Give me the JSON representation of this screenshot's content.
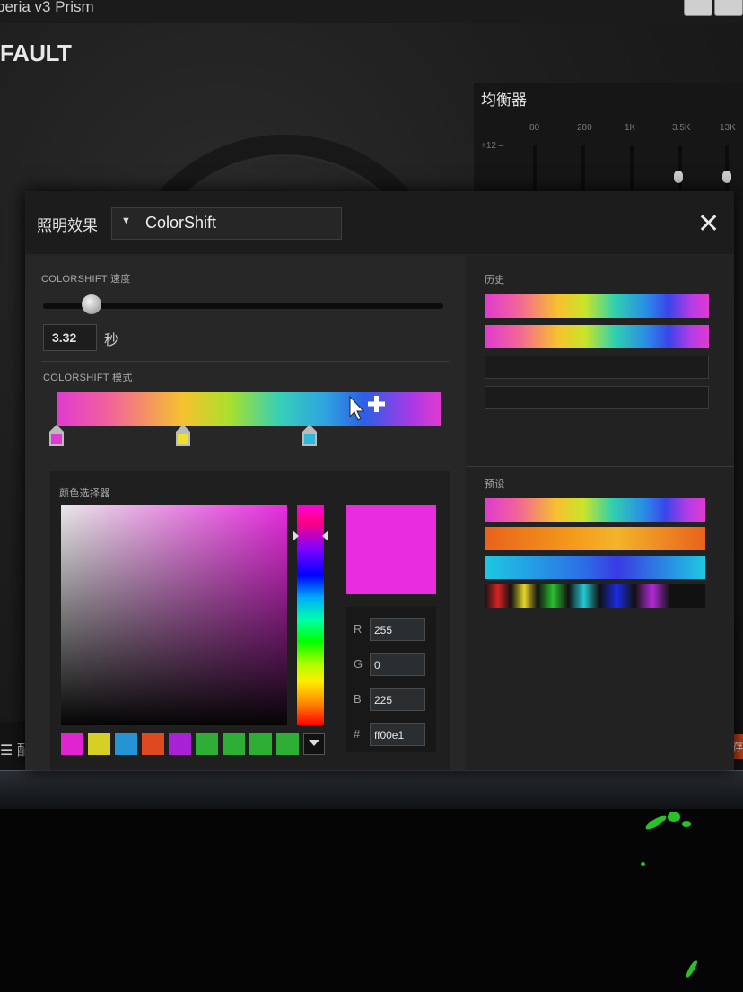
{
  "app": {
    "window_title": "beria v3 Prism",
    "profile_name": "FAULT",
    "equalizer": {
      "title": "均衡器",
      "freqs": [
        "80",
        "280",
        "1K",
        "3.5K",
        "13K"
      ],
      "db_label": "+12 –"
    },
    "bottom_bar": {
      "save_label": "保存",
      "list_label": "☰ 配"
    }
  },
  "dialog": {
    "title": "照明效果",
    "effect": {
      "value": "ColorShift"
    },
    "close_label": "✕",
    "speed": {
      "label": "COLORSHIFT 速度",
      "value": "3.32",
      "unit": "秒",
      "fraction": 0.12
    },
    "pattern": {
      "label": "COLORSHIFT 模式",
      "stops": [
        {
          "color": "#e03ad0",
          "position": 0.0
        },
        {
          "color": "#f1e028",
          "position": 0.33
        },
        {
          "color": "#2fb8d8",
          "position": 0.66
        }
      ]
    },
    "color_picker": {
      "label": "颜色选择器",
      "preview_color": "#e92ce0",
      "r_label": "R",
      "r_value": "255",
      "g_label": "G",
      "g_value": "0",
      "b_label": "B",
      "b_value": "225",
      "hex_label": "#",
      "hex_value": "ff00e1",
      "swatches": [
        "#e024cf",
        "#d7cf25",
        "#2494d4",
        "#dd4a22",
        "#a821d4",
        "#2fae35",
        "#2fae35",
        "#2fae35",
        "#2fae35"
      ]
    },
    "history": {
      "label": "历史",
      "slots": [
        "rainbow",
        "rainbow",
        "empty",
        "empty"
      ]
    },
    "presets": {
      "label": "预设",
      "items": [
        "rainbow",
        "fire",
        "ocean",
        "spectrum-blocks"
      ]
    }
  }
}
